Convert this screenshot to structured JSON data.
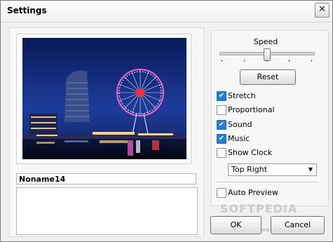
{
  "window": {
    "title": "Settings",
    "close_glyph": "✕"
  },
  "preview": {
    "name": "Noname14",
    "description": ""
  },
  "speed": {
    "label": "Speed",
    "value_fraction": 0.5
  },
  "reset_label": "Reset",
  "options": {
    "stretch": {
      "label": "Stretch",
      "checked": true
    },
    "proportional": {
      "label": "Proportional",
      "checked": false
    },
    "sound": {
      "label": "Sound",
      "checked": true
    },
    "music": {
      "label": "Music",
      "checked": true
    },
    "show_clock": {
      "label": "Show Clock",
      "checked": false
    },
    "auto_preview": {
      "label": "Auto Preview",
      "checked": false
    }
  },
  "clock_position": {
    "selected": "Top Right"
  },
  "buttons": {
    "ok": "OK",
    "cancel": "Cancel"
  },
  "watermark": {
    "text": "SOFTPEDIA",
    "url": "www.softpedia.com"
  },
  "colors": {
    "checkbox_checked": "#1f7fd6",
    "window_bg": "#f0f0f0"
  }
}
